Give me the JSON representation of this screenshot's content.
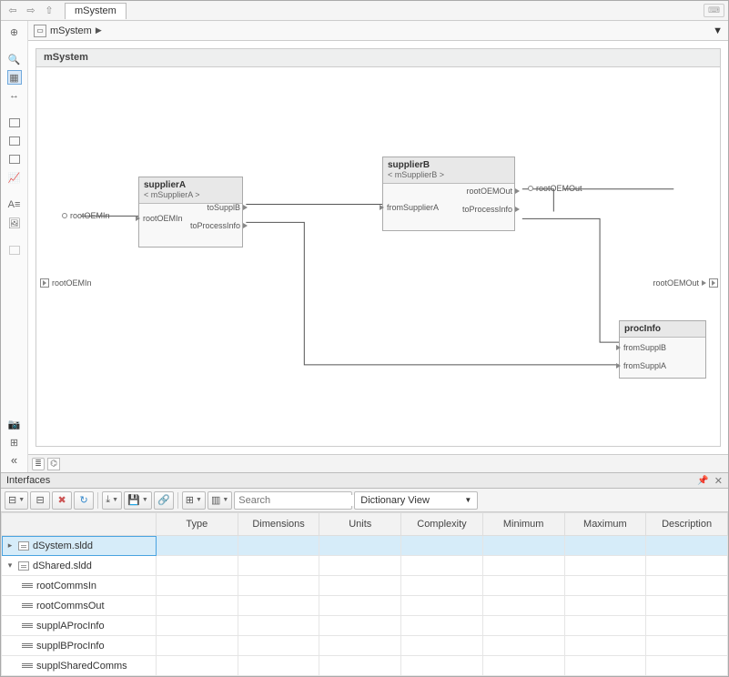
{
  "topbar": {
    "tab_label": "mSystem",
    "kbd": "⌨"
  },
  "breadcrumb": {
    "name": "mSystem"
  },
  "system_title": "mSystem",
  "ext_ports": {
    "left_label": "rootOEMIn",
    "right_label": "rootOEMOut"
  },
  "blocks": {
    "supplierA": {
      "title": "supplierA",
      "subtitle": "< mSupplierA >",
      "in": [
        "rootOEMIn"
      ],
      "out": [
        "toSupplB",
        "toProcessInfo"
      ]
    },
    "supplierB": {
      "title": "supplierB",
      "subtitle": "< mSupplierB >",
      "in": [
        "fromSupplierA"
      ],
      "out_up": [
        "rootOEMOut"
      ],
      "out_down": [
        "toProcessInfo"
      ],
      "ext_out": "rootOEMOut"
    },
    "procInfo": {
      "title": "procInfo",
      "in": [
        "fromSupplB",
        "fromSupplA"
      ]
    }
  },
  "interfaces_panel": {
    "title": "Interfaces",
    "search_placeholder": "Search",
    "view_label": "Dictionary View",
    "columns": [
      "",
      "Type",
      "Dimensions",
      "Units",
      "Complexity",
      "Minimum",
      "Maximum",
      "Description"
    ],
    "rows": [
      {
        "name": "dSystem.sldd",
        "kind": "dict",
        "selected": true,
        "expander": "▸"
      },
      {
        "name": "dShared.sldd",
        "kind": "dict",
        "selected": false,
        "expander": "▾"
      },
      {
        "name": "rootCommsIn",
        "kind": "signal"
      },
      {
        "name": "rootCommsOut",
        "kind": "signal"
      },
      {
        "name": "supplAProcInfo",
        "kind": "signal"
      },
      {
        "name": "supplBProcInfo",
        "kind": "signal"
      },
      {
        "name": "supplSharedComms",
        "kind": "signal"
      }
    ]
  }
}
